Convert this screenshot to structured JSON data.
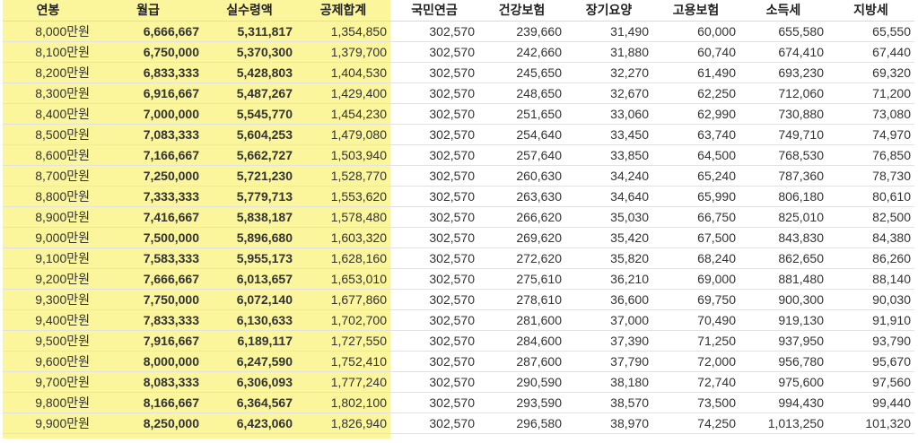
{
  "headers": [
    "연봉",
    "월급",
    "실수령액",
    "공제합계",
    "국민연금",
    "건강보험",
    "장기요양",
    "고용보험",
    "소득세",
    "지방세"
  ],
  "rows": [
    [
      "8,000만원",
      "6,666,667",
      "5,311,817",
      "1,354,850",
      "302,570",
      "239,660",
      "31,490",
      "60,000",
      "655,580",
      "65,550"
    ],
    [
      "8,100만원",
      "6,750,000",
      "5,370,300",
      "1,379,700",
      "302,570",
      "242,660",
      "31,880",
      "60,740",
      "674,410",
      "67,440"
    ],
    [
      "8,200만원",
      "6,833,333",
      "5,428,803",
      "1,404,530",
      "302,570",
      "245,650",
      "32,270",
      "61,490",
      "693,230",
      "69,320"
    ],
    [
      "8,300만원",
      "6,916,667",
      "5,487,267",
      "1,429,400",
      "302,570",
      "248,650",
      "32,670",
      "62,250",
      "712,060",
      "71,200"
    ],
    [
      "8,400만원",
      "7,000,000",
      "5,545,770",
      "1,454,230",
      "302,570",
      "251,650",
      "33,060",
      "62,990",
      "730,880",
      "73,080"
    ],
    [
      "8,500만원",
      "7,083,333",
      "5,604,253",
      "1,479,080",
      "302,570",
      "254,640",
      "33,450",
      "63,740",
      "749,710",
      "74,970"
    ],
    [
      "8,600만원",
      "7,166,667",
      "5,662,727",
      "1,503,940",
      "302,570",
      "257,640",
      "33,850",
      "64,500",
      "768,530",
      "76,850"
    ],
    [
      "8,700만원",
      "7,250,000",
      "5,721,230",
      "1,528,770",
      "302,570",
      "260,630",
      "34,240",
      "65,240",
      "787,360",
      "78,730"
    ],
    [
      "8,800만원",
      "7,333,333",
      "5,779,713",
      "1,553,620",
      "302,570",
      "263,630",
      "34,640",
      "65,990",
      "806,180",
      "80,610"
    ],
    [
      "8,900만원",
      "7,416,667",
      "5,838,187",
      "1,578,480",
      "302,570",
      "266,620",
      "35,030",
      "66,750",
      "825,010",
      "82,500"
    ],
    [
      "9,000만원",
      "7,500,000",
      "5,896,680",
      "1,603,320",
      "302,570",
      "269,620",
      "35,420",
      "67,500",
      "843,830",
      "84,380"
    ],
    [
      "9,100만원",
      "7,583,333",
      "5,955,173",
      "1,628,160",
      "302,570",
      "272,620",
      "35,820",
      "68,240",
      "862,650",
      "86,260"
    ],
    [
      "9,200만원",
      "7,666,667",
      "6,013,657",
      "1,653,010",
      "302,570",
      "275,610",
      "36,210",
      "69,000",
      "881,480",
      "88,140"
    ],
    [
      "9,300만원",
      "7,750,000",
      "6,072,140",
      "1,677,860",
      "302,570",
      "278,610",
      "36,600",
      "69,750",
      "900,300",
      "90,030"
    ],
    [
      "9,400만원",
      "7,833,333",
      "6,130,633",
      "1,702,700",
      "302,570",
      "281,600",
      "37,000",
      "70,490",
      "919,130",
      "91,910"
    ],
    [
      "9,500만원",
      "7,916,667",
      "6,189,117",
      "1,727,550",
      "302,570",
      "284,600",
      "37,390",
      "71,250",
      "937,950",
      "93,790"
    ],
    [
      "9,600만원",
      "8,000,000",
      "6,247,590",
      "1,752,410",
      "302,570",
      "287,600",
      "37,790",
      "72,000",
      "956,780",
      "95,670"
    ],
    [
      "9,700만원",
      "8,083,333",
      "6,306,093",
      "1,777,240",
      "302,570",
      "290,590",
      "38,180",
      "72,740",
      "975,600",
      "97,560"
    ],
    [
      "9,800만원",
      "8,166,667",
      "6,364,567",
      "1,802,100",
      "302,570",
      "293,590",
      "38,570",
      "73,500",
      "994,430",
      "99,440"
    ],
    [
      "9,900만원",
      "8,250,000",
      "6,423,060",
      "1,826,940",
      "302,570",
      "296,580",
      "38,970",
      "74,250",
      "1,013,250",
      "101,320"
    ]
  ],
  "colors": {
    "highlight_bg": "#fbf59b",
    "net_pay_text": "#d42a2a"
  }
}
